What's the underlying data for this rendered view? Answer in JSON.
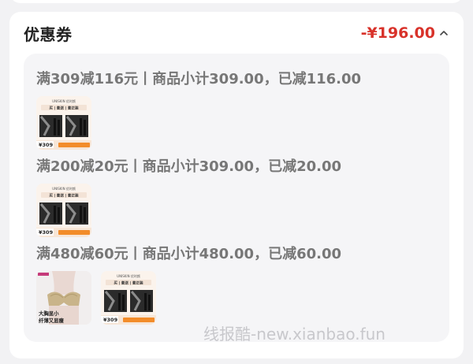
{
  "coupon_section": {
    "title": "优惠券",
    "total_discount": "-¥196.00"
  },
  "promotions": [
    {
      "label": "满309减116元丨商品小计309.00，已减116.00",
      "products": [
        {
          "type": "mascara",
          "header": "UNISKIN 优时颜",
          "promo": "买 | 套送 | 套正装",
          "price": "¥309"
        }
      ]
    },
    {
      "label": "满200减20元丨商品小计309.00，已减20.00",
      "products": [
        {
          "type": "mascara",
          "header": "UNISKIN 优时颜",
          "promo": "买 | 套送 | 套正装",
          "price": "¥309"
        }
      ]
    },
    {
      "label": "满480减60元丨商品小计480.00，已减60.00",
      "products": [
        {
          "type": "lingerie",
          "caption_line1": "大胸显小",
          "caption_line2": "纤薄又显瘦"
        },
        {
          "type": "mascara",
          "header": "UNISKIN 优时颜",
          "promo": "买 | 套送 | 套正装",
          "price": "¥309"
        }
      ]
    }
  ],
  "watermark": "线报酷-new.xianbao.fun"
}
